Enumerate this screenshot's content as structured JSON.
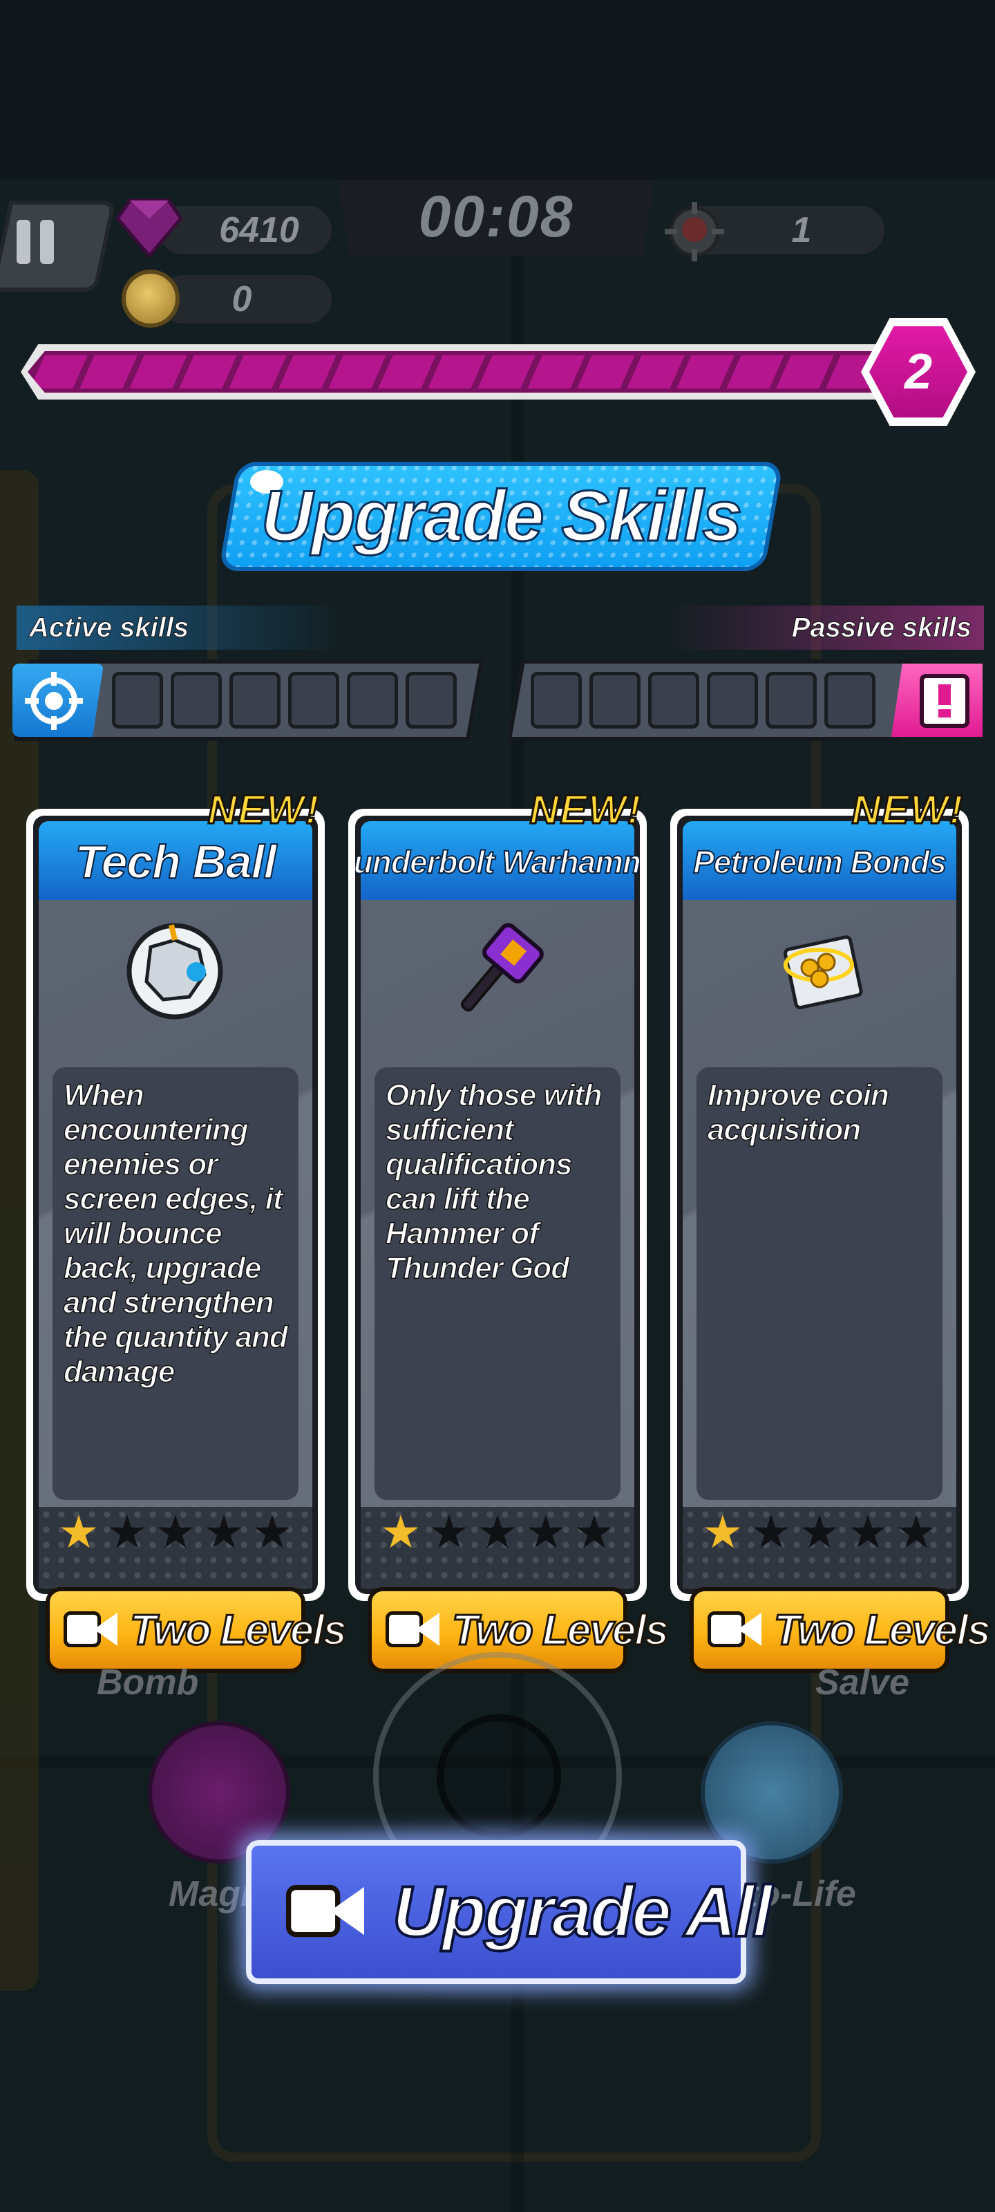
{
  "hud": {
    "gems": "6410",
    "coins": "0",
    "timer": "00:08",
    "kills": "1",
    "level": "2",
    "progress_fraction": 1.0
  },
  "title": "Upgrade Skills",
  "skill_bars": {
    "active_label": "Active skills",
    "passive_label": "Passive skills",
    "active_slots_empty": 6,
    "passive_slots_empty": 6
  },
  "cards": [
    {
      "tag": "NEW!",
      "name": "Tech Ball",
      "description": "When encountering enemies or screen edges, it will bounce back, upgrade and strengthen the quantity and damage",
      "stars_filled": 1,
      "stars_total": 5,
      "button_label": "Two Levels",
      "icon": "tech-ball-icon"
    },
    {
      "tag": "NEW!",
      "name": "Thunderbolt Warhammer",
      "description": "Only those with sufficient qualifications can lift the Hammer of Thunder God",
      "stars_filled": 1,
      "stars_total": 5,
      "button_label": "Two Levels",
      "icon": "warhammer-icon"
    },
    {
      "tag": "NEW!",
      "name": "Petroleum Bonds",
      "description": "Improve coin acquisition",
      "stars_filled": 1,
      "stars_total": 5,
      "button_label": "Two Levels",
      "icon": "bonds-icon"
    }
  ],
  "background": {
    "label_left": "Bomb",
    "label_right": "Salve",
    "label_magnet": "Magn",
    "label_life": "to-Life"
  },
  "upgrade_all_label": "Upgrade All",
  "colors": {
    "accent_blue": "#1e9cf0",
    "gold": "#ffb514",
    "magenta": "#b5168d"
  }
}
